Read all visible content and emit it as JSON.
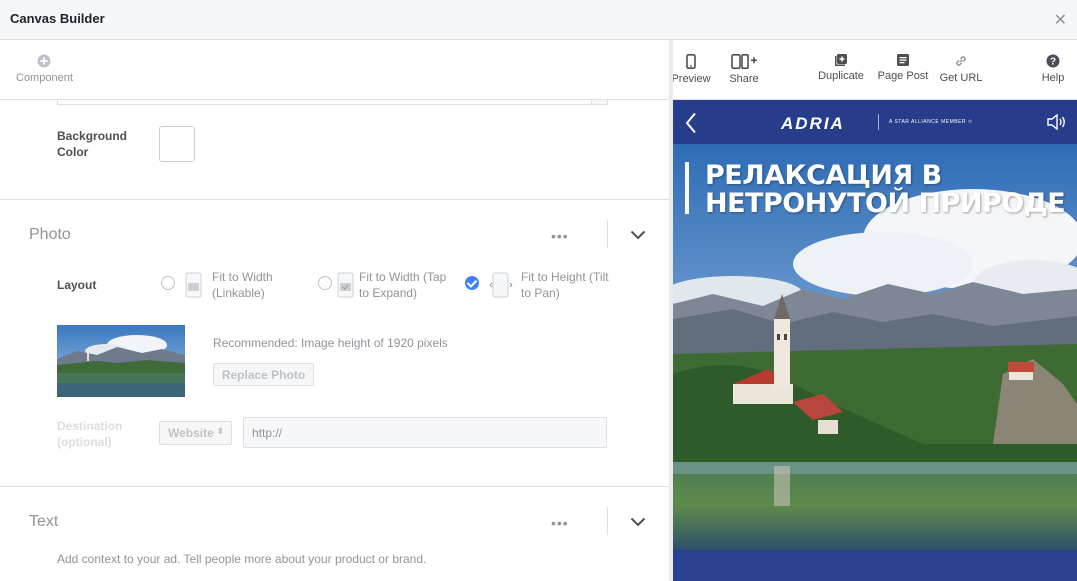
{
  "window": {
    "title": "Canvas Builder"
  },
  "toolbar": {
    "component": "Component",
    "preview": "Preview",
    "share": "Share",
    "duplicate": "Duplicate",
    "page_post": "Page Post",
    "get_url": "Get URL",
    "help": "Help"
  },
  "background": {
    "label": "Background Color",
    "color": "#ffffff"
  },
  "photo": {
    "title": "Photo",
    "layout_label": "Layout",
    "options": [
      {
        "label": "Fit to Width (Linkable)",
        "checked": false
      },
      {
        "label": "Fit to Width (Tap to Expand)",
        "checked": false
      },
      {
        "label": "Fit to Height (Tilt to Pan)",
        "checked": true
      }
    ],
    "recommended": "Recommended: Image height of 1920 pixels",
    "replace_button": "Replace Photo",
    "destination_label": "Destination (optional)",
    "destination_select": "Website",
    "url_placeholder": "http://"
  },
  "text_section": {
    "title": "Text",
    "description": "Add context to your ad. Tell people more about your product or brand."
  },
  "preview": {
    "headline_line1": "РЕЛАКСАЦИЯ В",
    "headline_line2": "НЕТРОНУТОЙ ПРИРОДЕ",
    "logo": "ADRIA",
    "logo_sub": "A STAR ALLIANCE MEMBER ✩"
  },
  "colors": {
    "accent": "#4080ff",
    "preview_blue": "#283c8c"
  }
}
